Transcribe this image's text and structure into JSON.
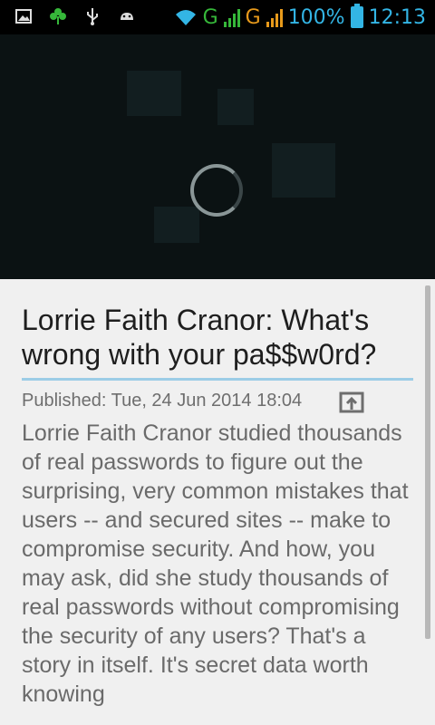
{
  "status_bar": {
    "network_1": "G",
    "network_2": "G",
    "battery_pct": "100%",
    "time": "12:13",
    "icons": [
      "image-icon",
      "clover-icon",
      "usb-icon",
      "android-icon",
      "wifi-icon",
      "signal-icon",
      "signal-icon",
      "battery-icon"
    ]
  },
  "video": {
    "state": "loading",
    "spinner_icon": "loading-spinner-icon"
  },
  "article": {
    "title": "Lorrie Faith Cranor: What's wrong with your pa$$w0rd?",
    "published": "Published: Tue, 24 Jun 2014 18:04",
    "share_icon": "open-external-icon",
    "description": "Lorrie Faith Cranor studied thousands of real passwords to figure out the surprising, very common mistakes that users -- and secured sites -- make to compromise security. And how, you may ask, did she study thousands of real passwords without compromising the security of any users? That's a story in itself. It's secret data worth knowing"
  },
  "colors": {
    "accent": "#33b5e5",
    "title_underline": "#9ccde6",
    "background": "#f0f0f0"
  }
}
